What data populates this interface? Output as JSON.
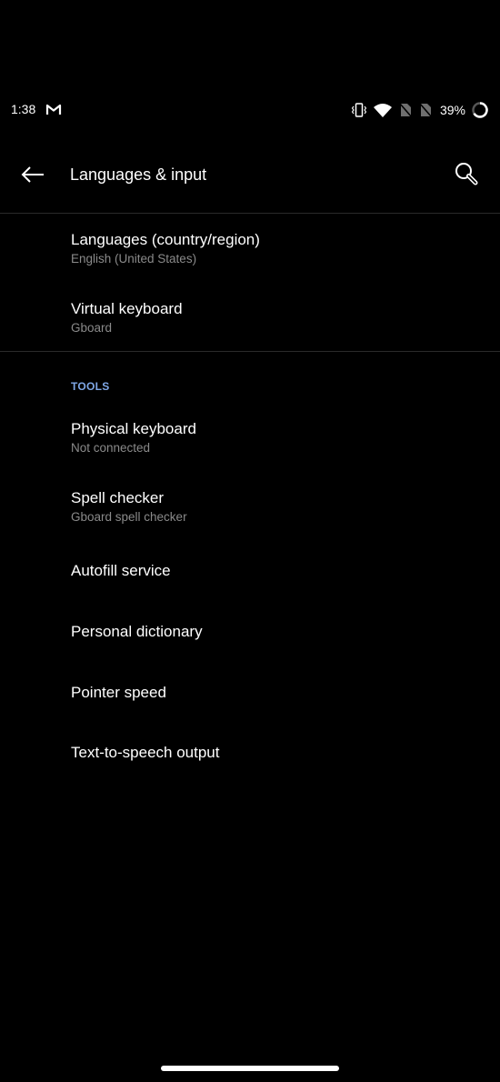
{
  "status_bar": {
    "time": "1:38",
    "notification_icons": [
      "gmail-icon"
    ],
    "system_icons": [
      "vibrate-icon",
      "wifi-icon",
      "no-sim-icon",
      "no-sim-icon"
    ],
    "battery_percent": "39%"
  },
  "app_bar": {
    "title": "Languages & input",
    "back_icon": "arrow-left-icon",
    "search_icon": "search-icon"
  },
  "colors": {
    "background": "#000000",
    "accent": "#7fa7e6",
    "subtitle": "#8a8a8a",
    "divider": "#2a2a2a"
  },
  "main": {
    "items": [
      {
        "title": "Languages (country/region)",
        "subtitle": "English (United States)"
      },
      {
        "title": "Virtual keyboard",
        "subtitle": "Gboard"
      }
    ],
    "tools_section": {
      "header": "TOOLS",
      "items": [
        {
          "title": "Physical keyboard",
          "subtitle": "Not connected"
        },
        {
          "title": "Spell checker",
          "subtitle": "Gboard spell checker"
        },
        {
          "title": "Autofill service"
        },
        {
          "title": "Personal dictionary"
        },
        {
          "title": "Pointer speed"
        },
        {
          "title": "Text-to-speech output"
        }
      ]
    }
  }
}
